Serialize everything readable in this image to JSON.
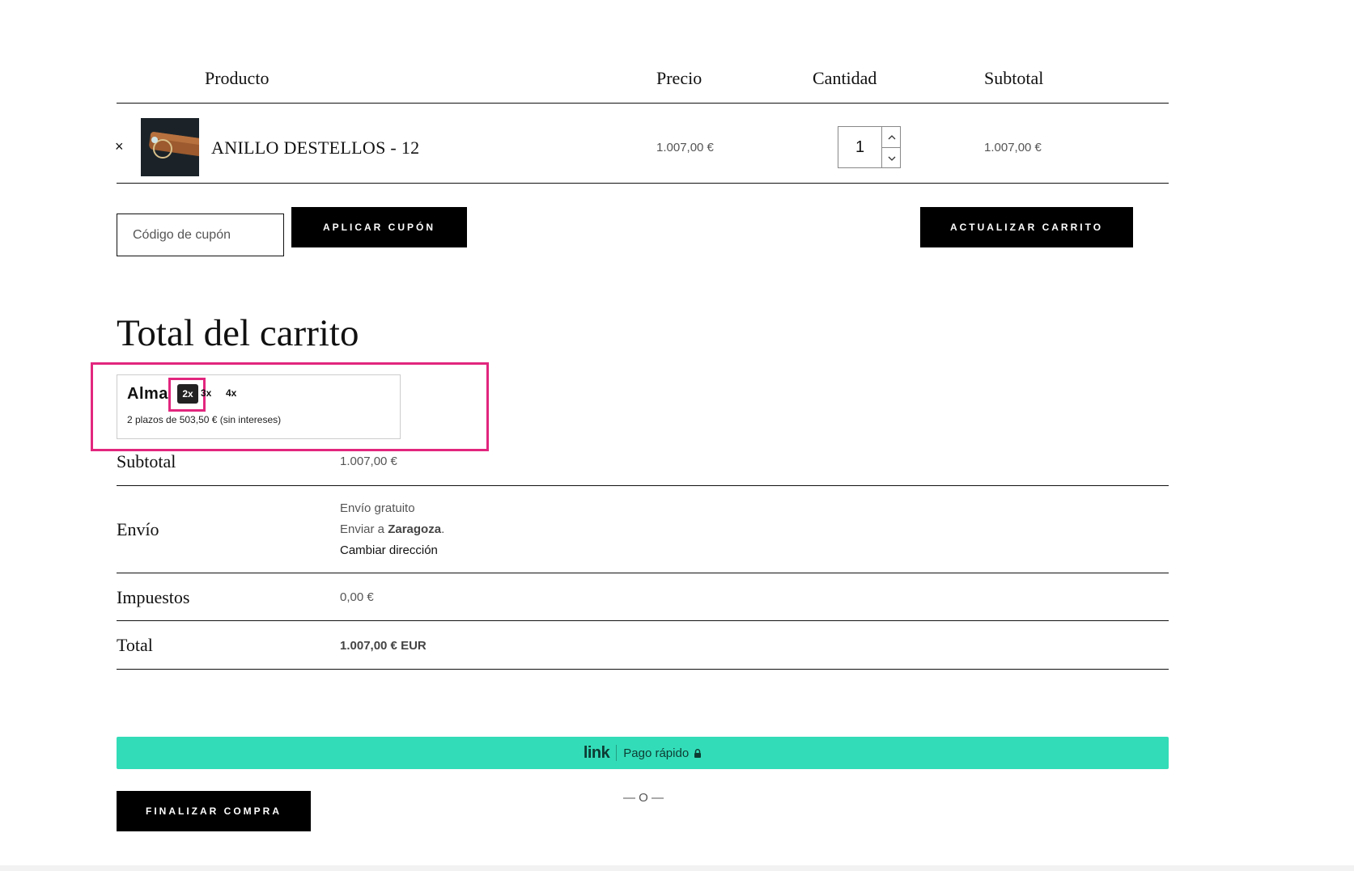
{
  "cart_table": {
    "headers": {
      "product": "Producto",
      "price": "Precio",
      "quantity": "Cantidad",
      "subtotal": "Subtotal"
    },
    "items": [
      {
        "remove": "×",
        "name": "ANILLO DESTELLOS - 12",
        "price": "1.007,00 €",
        "quantity": "1",
        "subtotal": "1.007,00 €"
      }
    ]
  },
  "coupon": {
    "placeholder": "Código de cupón",
    "apply_label": "APLICAR CUPÓN"
  },
  "update_cart_label": "ACTUALIZAR CARRITO",
  "totals": {
    "title": "Total del carrito",
    "alma": {
      "logo": "Alma",
      "options": [
        "2x",
        "3x",
        "4x"
      ],
      "selected": "2x",
      "description": "2 plazos de 503,50 € (sin intereses)"
    },
    "subtotal_label": "Subtotal",
    "subtotal_value": "1.007,00 €",
    "shipping_label": "Envío",
    "shipping_method": "Envío gratuito",
    "shipping_to_prefix": "Enviar a ",
    "shipping_city": "Zaragoza",
    "shipping_to_suffix": ".",
    "change_address": "Cambiar dirección",
    "taxes_label": "Impuestos",
    "taxes_value": "0,00 €",
    "total_label": "Total",
    "total_value": "1.007,00 € EUR"
  },
  "express_checkout": {
    "logo": "link",
    "label": "Pago rápido",
    "icon": "lock-icon"
  },
  "or_separator": "— O —",
  "checkout_label": "FINALIZAR COMPRA",
  "colors": {
    "accent_highlight": "#e2267e",
    "link_green": "#33dcb8",
    "button_black": "#000000"
  }
}
